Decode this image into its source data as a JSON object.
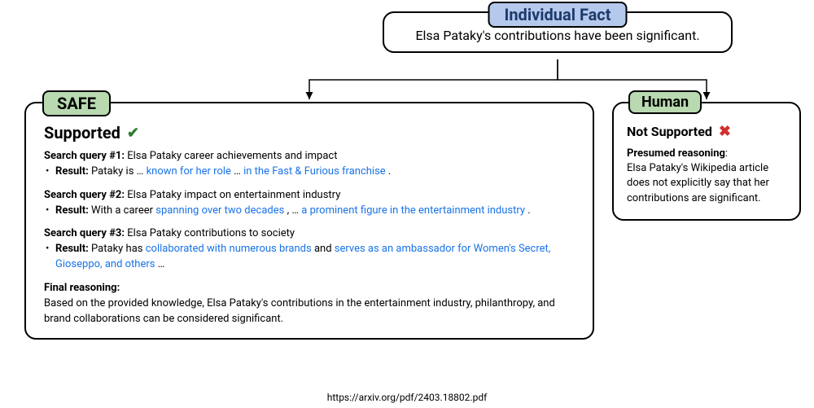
{
  "top": {
    "title": "Individual Fact",
    "content": "Elsa Pataky's contributions have been significant."
  },
  "safe": {
    "title": "SAFE",
    "verdict": "Supported",
    "queries": [
      {
        "label": "Search query #1:",
        "text": "Elsa Pataky career achievements and impact",
        "result_label": "Result:",
        "result_pre": "Pataky is …",
        "result_link1": "known for her role",
        "result_mid": " … ",
        "result_link2": "in the Fast & Furious franchise",
        "result_post": "."
      },
      {
        "label": "Search query #2:",
        "text": "Elsa Pataky impact on entertainment industry",
        "result_label": "Result:",
        "result_pre": "With a career ",
        "result_link1": "spanning over two decades",
        "result_mid": ", … ",
        "result_link2": "a prominent figure in the entertainment industry",
        "result_post": "."
      },
      {
        "label": "Search query #3:",
        "text": "Elsa Pataky contributions to society",
        "result_label": "Result:",
        "result_pre": "Pataky has ",
        "result_link1": "collaborated with numerous brands",
        "result_mid": " and ",
        "result_link2": "serves as an ambassador for Women's Secret, Gioseppo, and others",
        "result_post": " …"
      }
    ],
    "final_label": "Final reasoning:",
    "final_text": "Based on the provided knowledge, Elsa Pataky's contributions in the entertainment industry, philanthropy, and brand collaborations can be considered significant."
  },
  "human": {
    "title": "Human",
    "verdict": "Not Supported",
    "reason_label": "Presumed reasoning",
    "reason_text": "Elsa Pataky's Wikipedia article does not explicitly say that her contributions are significant."
  },
  "source": "https://arxiv.org/pdf/2403.18802.pdf"
}
